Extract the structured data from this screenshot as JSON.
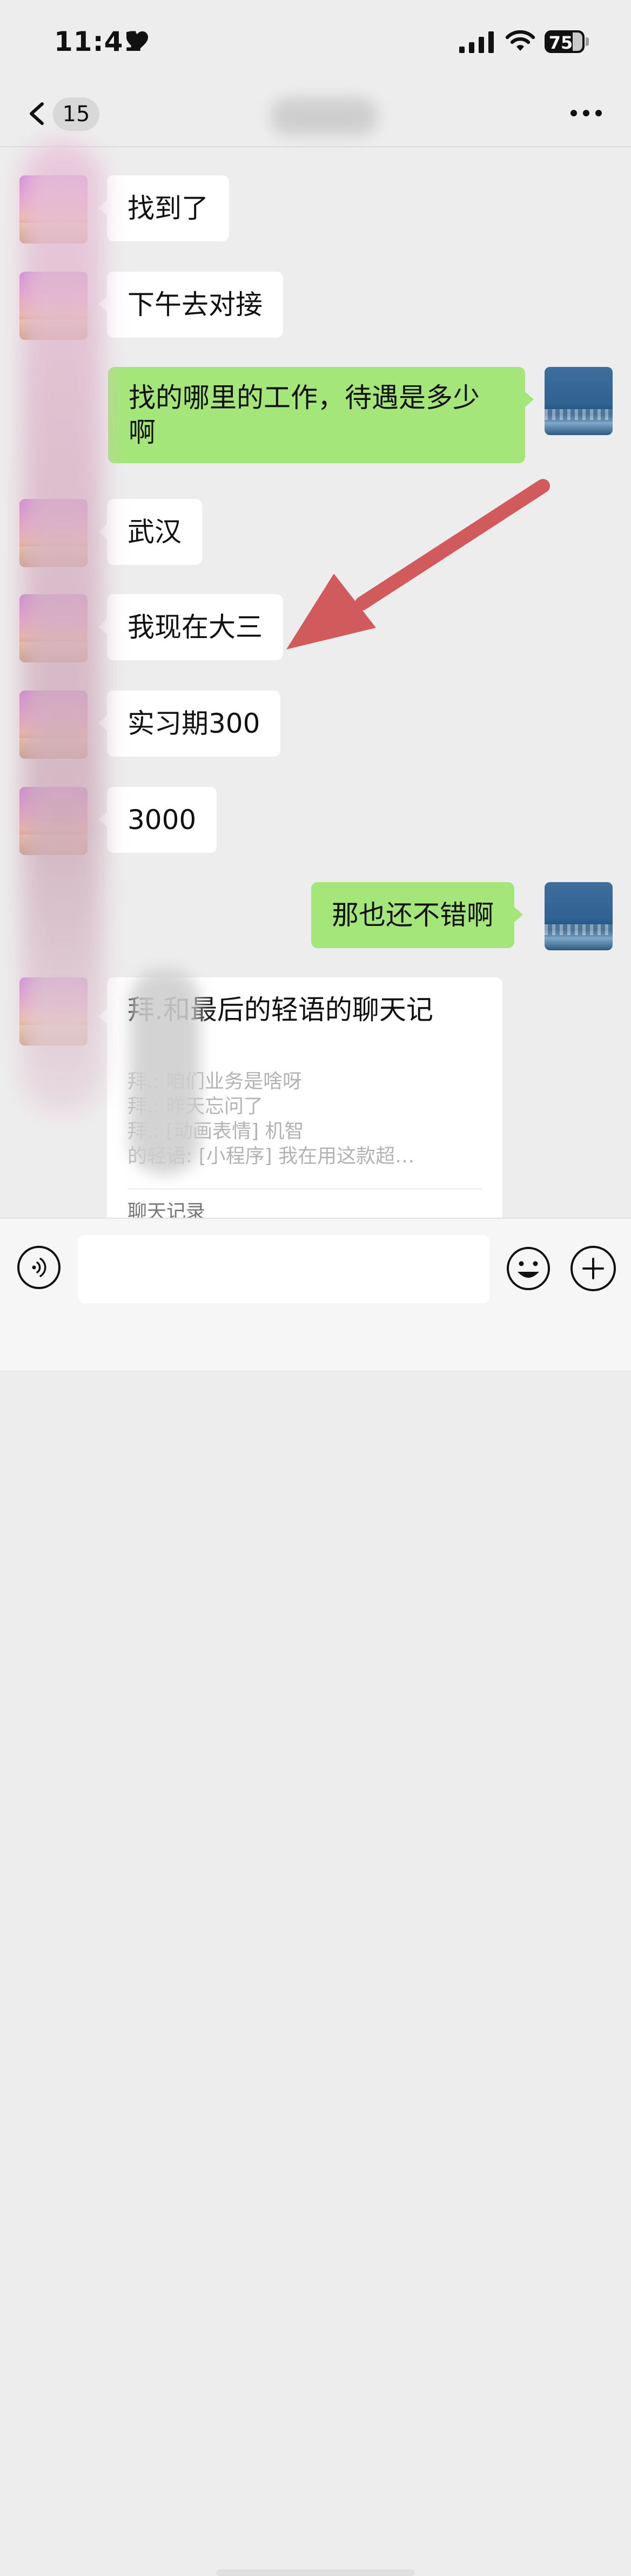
{
  "status_bar": {
    "time": "11:41",
    "battery": "75"
  },
  "nav": {
    "unread_count": "15"
  },
  "messages": [
    {
      "dir": "in",
      "text": "找到了"
    },
    {
      "dir": "in",
      "text": "下午去对接"
    },
    {
      "dir": "out",
      "text": "找的哪里的工作，待遇是多少啊"
    },
    {
      "dir": "in",
      "text": "武汉"
    },
    {
      "dir": "in",
      "text": "我现在大三"
    },
    {
      "dir": "in",
      "text": "实习期300"
    },
    {
      "dir": "in",
      "text": "3000"
    },
    {
      "dir": "out",
      "text": "那也还不错啊"
    }
  ],
  "chat_record": {
    "title": "拜.和最后的轻语的聊天记",
    "lines": [
      "拜.: 咱们业务是啥呀",
      "拜.: 昨天忘问了",
      "拜.: [动画表情] 机智",
      "的轻语: [小程序] 我在用这款超…"
    ],
    "label": "聊天记录"
  },
  "input": {
    "placeholder": ""
  },
  "colors": {
    "outgoing_bubble": "#a5e67b",
    "incoming_bubble": "#ffffff",
    "background": "#ededed",
    "annotation_arrow": "#d05a5c"
  }
}
